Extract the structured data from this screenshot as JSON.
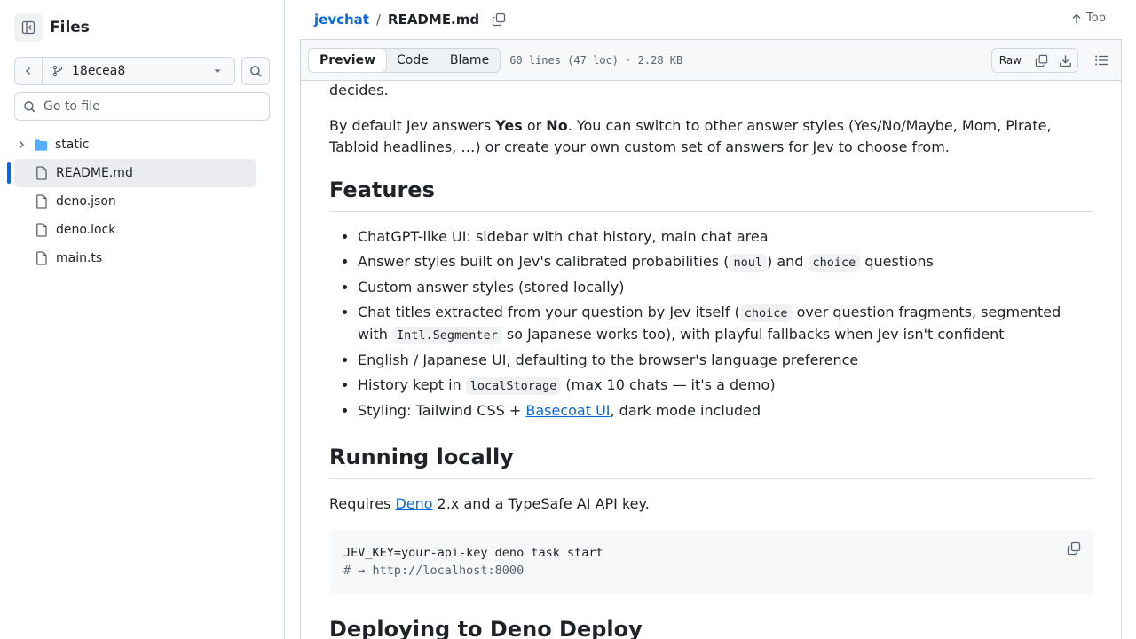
{
  "sidebar": {
    "title": "Files",
    "branch": "18ecea8",
    "goto_placeholder": "Go to file",
    "tree": [
      {
        "name": "static",
        "type": "folder"
      },
      {
        "name": "README.md",
        "type": "file",
        "selected": true
      },
      {
        "name": "deno.json",
        "type": "file"
      },
      {
        "name": "deno.lock",
        "type": "file"
      },
      {
        "name": "main.ts",
        "type": "file"
      }
    ]
  },
  "header": {
    "repo": "jevchat",
    "sep": "/",
    "file": "README.md",
    "top_label": "Top"
  },
  "toolbar": {
    "tabs": [
      "Preview",
      "Code",
      "Blame"
    ],
    "active_tab": "Preview",
    "file_info": "60 lines (47 loc) · 2.28 KB",
    "raw_label": "Raw"
  },
  "content": {
    "intro_tail": "decides.",
    "p1_a": "By default Jev answers ",
    "p1_yes": "Yes",
    "p1_or": " or ",
    "p1_no": "No",
    "p1_b": ". You can switch to other answer styles (Yes/No/Maybe, Mom, Pirate, Tabloid headlines, …) or create your own custom set of answers for Jev to choose from.",
    "features_heading": "Features",
    "f1": "ChatGPT-like UI: sidebar with chat history, main chat area",
    "f2_a": "Answer styles built on Jev's calibrated probabilities (",
    "f2_code1": "noul",
    "f2_b": ") and ",
    "f2_code2": "choice",
    "f2_c": " questions",
    "f3": "Custom answer styles (stored locally)",
    "f4_a": "Chat titles extracted from your question by Jev itself (",
    "f4_code1": "choice",
    "f4_b": " over question fragments, segmented with ",
    "f4_code2": "Intl.Segmenter",
    "f4_c": " so Japanese works too), with playful fallbacks when Jev isn't confident",
    "f5": "English / Japanese UI, defaulting to the browser's language preference",
    "f6_a": "History kept in ",
    "f6_code": "localStorage",
    "f6_b": " (max 10 chats — it's a demo)",
    "f7_a": "Styling: Tailwind CSS + ",
    "f7_link": "Basecoat UI",
    "f7_b": ", dark mode included",
    "running_heading": "Running locally",
    "req_a": "Requires ",
    "req_link": "Deno",
    "req_b": " 2.x and a TypeSafe AI API key.",
    "code_line1": "JEV_KEY=your-api-key deno task start",
    "code_line2": "# → http://localhost:8000",
    "deploy_heading": "Deploying to Deno Deploy"
  }
}
